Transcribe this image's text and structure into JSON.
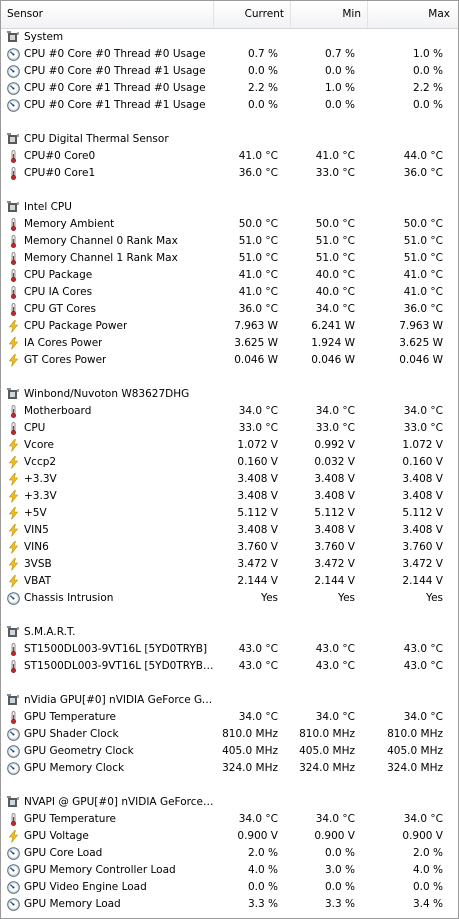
{
  "columns": {
    "sensor": "Sensor",
    "current": "Current",
    "min": "Min",
    "max": "Max"
  },
  "groups": [
    {
      "title": "System",
      "rows": [
        {
          "icon": "gauge-icon",
          "label": "CPU #0 Core #0 Thread #0 Usage",
          "current": "0.7 %",
          "min": "0.7 %",
          "max": "1.0 %"
        },
        {
          "icon": "gauge-icon",
          "label": "CPU #0 Core #0 Thread #1 Usage",
          "current": "0.0 %",
          "min": "0.0 %",
          "max": "0.0 %"
        },
        {
          "icon": "gauge-icon",
          "label": "CPU #0 Core #1 Thread #0 Usage",
          "current": "2.2 %",
          "min": "1.0 %",
          "max": "2.2 %"
        },
        {
          "icon": "gauge-icon",
          "label": "CPU #0 Core #1 Thread #1 Usage",
          "current": "0.0 %",
          "min": "0.0 %",
          "max": "0.0 %"
        }
      ]
    },
    {
      "title": "CPU Digital Thermal Sensor",
      "rows": [
        {
          "icon": "thermometer-icon",
          "label": "CPU#0 Core0",
          "current": "41.0 °C",
          "min": "41.0 °C",
          "max": "44.0 °C"
        },
        {
          "icon": "thermometer-icon",
          "label": "CPU#0 Core1",
          "current": "36.0 °C",
          "min": "33.0 °C",
          "max": "36.0 °C"
        }
      ]
    },
    {
      "title": "Intel CPU",
      "rows": [
        {
          "icon": "thermometer-icon",
          "label": "Memory Ambient",
          "current": "50.0 °C",
          "min": "50.0 °C",
          "max": "50.0 °C"
        },
        {
          "icon": "thermometer-icon",
          "label": "Memory Channel 0 Rank Max",
          "current": "51.0 °C",
          "min": "51.0 °C",
          "max": "51.0 °C"
        },
        {
          "icon": "thermometer-icon",
          "label": "Memory Channel 1 Rank Max",
          "current": "51.0 °C",
          "min": "51.0 °C",
          "max": "51.0 °C"
        },
        {
          "icon": "thermometer-icon",
          "label": "CPU Package",
          "current": "41.0 °C",
          "min": "40.0 °C",
          "max": "41.0 °C"
        },
        {
          "icon": "thermometer-icon",
          "label": "CPU IA Cores",
          "current": "41.0 °C",
          "min": "40.0 °C",
          "max": "41.0 °C"
        },
        {
          "icon": "thermometer-icon",
          "label": "CPU GT Cores",
          "current": "36.0 °C",
          "min": "34.0 °C",
          "max": "36.0 °C"
        },
        {
          "icon": "bolt-icon",
          "label": "CPU Package Power",
          "current": "7.963 W",
          "min": "6.241 W",
          "max": "7.963 W"
        },
        {
          "icon": "bolt-icon",
          "label": "IA Cores Power",
          "current": "3.625 W",
          "min": "1.924 W",
          "max": "3.625 W"
        },
        {
          "icon": "bolt-icon",
          "label": "GT Cores Power",
          "current": "0.046 W",
          "min": "0.046 W",
          "max": "0.046 W"
        }
      ]
    },
    {
      "title": "Winbond/Nuvoton W83627DHG",
      "rows": [
        {
          "icon": "thermometer-icon",
          "label": "Motherboard",
          "current": "34.0 °C",
          "min": "34.0 °C",
          "max": "34.0 °C"
        },
        {
          "icon": "thermometer-icon",
          "label": "CPU",
          "current": "33.0 °C",
          "min": "33.0 °C",
          "max": "33.0 °C"
        },
        {
          "icon": "bolt-icon",
          "label": "Vcore",
          "current": "1.072 V",
          "min": "0.992 V",
          "max": "1.072 V"
        },
        {
          "icon": "bolt-icon",
          "label": "Vccp2",
          "current": "0.160 V",
          "min": "0.032 V",
          "max": "0.160 V"
        },
        {
          "icon": "bolt-icon",
          "label": "+3.3V",
          "current": "3.408 V",
          "min": "3.408 V",
          "max": "3.408 V"
        },
        {
          "icon": "bolt-icon",
          "label": "+3.3V",
          "current": "3.408 V",
          "min": "3.408 V",
          "max": "3.408 V"
        },
        {
          "icon": "bolt-icon",
          "label": "+5V",
          "current": "5.112 V",
          "min": "5.112 V",
          "max": "5.112 V"
        },
        {
          "icon": "bolt-icon",
          "label": "VIN5",
          "current": "3.408 V",
          "min": "3.408 V",
          "max": "3.408 V"
        },
        {
          "icon": "bolt-icon",
          "label": "VIN6",
          "current": "3.760 V",
          "min": "3.760 V",
          "max": "3.760 V"
        },
        {
          "icon": "bolt-icon",
          "label": "3VSB",
          "current": "3.472 V",
          "min": "3.472 V",
          "max": "3.472 V"
        },
        {
          "icon": "bolt-icon",
          "label": "VBAT",
          "current": "2.144 V",
          "min": "2.144 V",
          "max": "2.144 V"
        },
        {
          "icon": "gauge-icon",
          "label": "Chassis Intrusion",
          "current": "Yes",
          "min": "Yes",
          "max": "Yes"
        }
      ]
    },
    {
      "title": "S.M.A.R.T.",
      "rows": [
        {
          "icon": "thermometer-icon",
          "label": "ST1500DL003-9VT16L [5YD0TRYB]",
          "current": "43.0 °C",
          "min": "43.0 °C",
          "max": "43.0 °C"
        },
        {
          "icon": "thermometer-icon",
          "label": "ST1500DL003-9VT16L [5YD0TRYB] ...",
          "current": "43.0 °C",
          "min": "43.0 °C",
          "max": "43.0 °C"
        }
      ]
    },
    {
      "title": "nVidia GPU[#0] nVIDIA GeForce GT ...",
      "rows": [
        {
          "icon": "thermometer-icon",
          "label": "GPU Temperature",
          "current": "34.0 °C",
          "min": "34.0 °C",
          "max": "34.0 °C"
        },
        {
          "icon": "gauge-icon",
          "label": "GPU Shader Clock",
          "current": "810.0 MHz",
          "min": "810.0 MHz",
          "max": "810.0 MHz"
        },
        {
          "icon": "gauge-icon",
          "label": "GPU Geometry Clock",
          "current": "405.0 MHz",
          "min": "405.0 MHz",
          "max": "405.0 MHz"
        },
        {
          "icon": "gauge-icon",
          "label": "GPU Memory Clock",
          "current": "324.0 MHz",
          "min": "324.0 MHz",
          "max": "324.0 MHz"
        }
      ]
    },
    {
      "title": "NVAPI @ GPU[#0] nVIDIA GeForce ...",
      "rows": [
        {
          "icon": "thermometer-icon",
          "label": "GPU Temperature",
          "current": "34.0 °C",
          "min": "34.0 °C",
          "max": "34.0 °C"
        },
        {
          "icon": "bolt-icon",
          "label": "GPU Voltage",
          "current": "0.900 V",
          "min": "0.900 V",
          "max": "0.900 V"
        },
        {
          "icon": "gauge-icon",
          "label": "GPU Core Load",
          "current": "2.0 %",
          "min": "0.0 %",
          "max": "2.0 %"
        },
        {
          "icon": "gauge-icon",
          "label": "GPU Memory Controller Load",
          "current": "4.0 %",
          "min": "3.0 %",
          "max": "4.0 %"
        },
        {
          "icon": "gauge-icon",
          "label": "GPU Video Engine Load",
          "current": "0.0 %",
          "min": "0.0 %",
          "max": "0.0 %"
        },
        {
          "icon": "gauge-icon",
          "label": "GPU Memory Load",
          "current": "3.3 %",
          "min": "3.3 %",
          "max": "3.4 %"
        }
      ]
    }
  ]
}
